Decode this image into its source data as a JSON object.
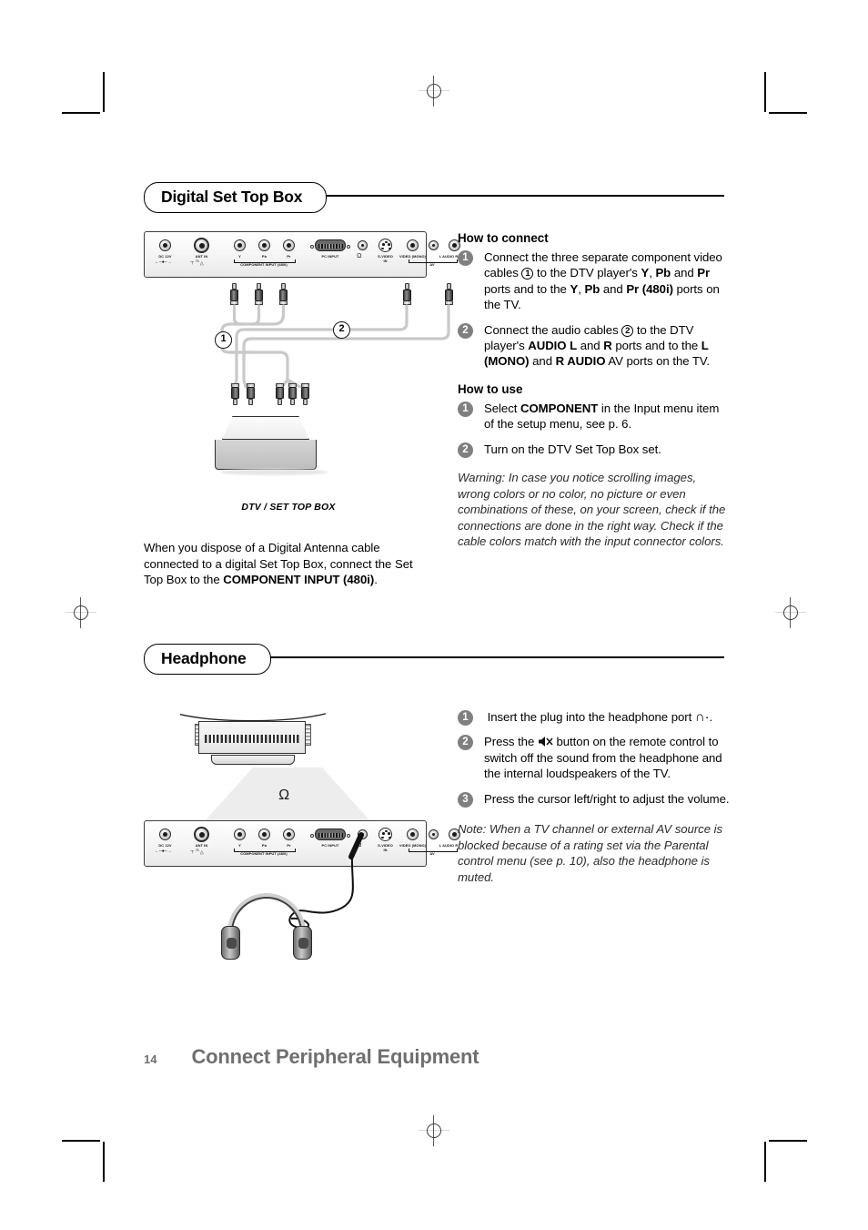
{
  "page": {
    "number": "14",
    "footer_title": "Connect Peripheral Equipment"
  },
  "sections": [
    {
      "id": "digital-set-top-box",
      "heading": "Digital Set Top Box",
      "diagram_caption": "DTV / SET TOP BOX",
      "diagram_markers": {
        "one": "1",
        "two": "2"
      },
      "left_paragraph_html": "When you dispose of a Digital Antenna cable connected to a digital Set Top Box, connect the Set Top Box to the <b>COMPONENT INPUT (480i)</b>.",
      "how_to_connect": {
        "title": "How to connect",
        "steps": [
          {
            "num": "1",
            "html": "Connect the three separate component video cables <span class=\"inline-num\">1</span> to the DTV player's <b>Y</b>, <b>Pb</b> and <b>Pr</b> ports and to the <b>Y</b>, <b>Pb</b> and <b>Pr (480i)</b> ports on the TV."
          },
          {
            "num": "2",
            "html": "Connect the audio cables <span class=\"inline-num\">2</span> to the DTV player's <b>AUDIO L</b> and <b>R</b> ports and to the <b>L (MONO)</b> and <b>R AUDIO</b> AV ports on the TV."
          }
        ]
      },
      "how_to_use": {
        "title": "How to use",
        "steps": [
          {
            "num": "1",
            "html": "Select <b>COMPONENT</b> in the Input menu item of the setup menu, see p. 6."
          },
          {
            "num": "2",
            "html": "Turn on the DTV Set Top Box set."
          }
        ],
        "warning": "Warning: In case you notice scrolling images, wrong colors or no color, no picture or even combinations of these, on your screen, check if the connections are done in the right way. Check if the cable colors match with the input connector colors."
      }
    },
    {
      "id": "headphone",
      "heading": "Headphone",
      "steps": [
        {
          "num": "1",
          "html": "&nbsp;Insert the plug into the headphone port <span class=\"hpglyph\">&#8729;</span>."
        },
        {
          "num": "2",
          "html": "Press the <span class=\"muteglyph\"></span> button on the remote control to switch off the sound from the headphone and the internal loudspeakers of the TV."
        },
        {
          "num": "3",
          "html": "Press the cursor left/right to adjust the volume."
        }
      ],
      "note": "Note: When a TV channel or external AV source is blocked because of a rating set via the Parental control menu (see p. 10), also the headphone is muted."
    }
  ],
  "connector_panel": {
    "labels": {
      "dc": "DC 12V",
      "ant": "ANT IN",
      "ant_ohm": "75",
      "y": "Y",
      "pb": "Pb",
      "pr": "Pr",
      "component": "COMPONENT INPUT (480i)",
      "pc": "PC INPUT",
      "headphone": "Ω",
      "svideo_line1": "S-VIDEO",
      "svideo_line2": "IN",
      "video_mono": "VIDEO (MONO)",
      "l_audio_r": "L AUDIO R",
      "av": "AV"
    }
  },
  "colors": {
    "bullet_gray": "#808080",
    "footer_gray": "#6f6f6f",
    "rule_black": "#000000",
    "cable_gray": "#c9c9c9"
  }
}
